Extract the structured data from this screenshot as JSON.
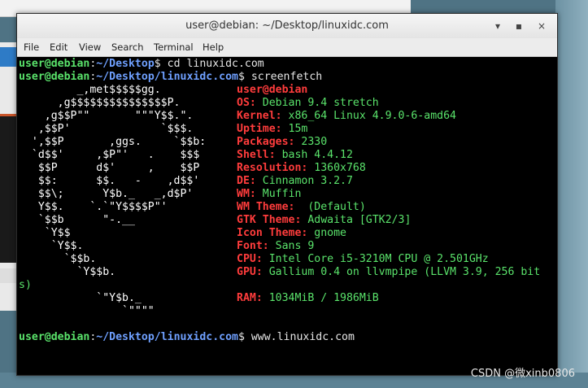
{
  "window": {
    "title": "user@debian: ~/Desktop/linuxidc.com",
    "controls": [
      "▾",
      "▪",
      "×"
    ]
  },
  "menu": [
    "File",
    "Edit",
    "View",
    "Search",
    "Terminal",
    "Help"
  ],
  "prompts": [
    {
      "user": "user@debian",
      "sep": ":",
      "path": "~/Desktop",
      "sym": "$",
      "cmd": " cd linuxidc.com"
    },
    {
      "user": "user@debian",
      "sep": ":",
      "path": "~/Desktop/linuxidc.com",
      "sym": "$",
      "cmd": " screenfetch"
    },
    {
      "user": "user@debian",
      "sep": ":",
      "path": "~/Desktop/linuxidc.com",
      "sym": "$",
      "cmd": " www.linuxidc.com"
    }
  ],
  "logo": [
    "         _,met$$$$$gg.",
    "      ,g$$$$$$$$$$$$$$$P.",
    "    ,g$$P\"\"       \"\"\"Y$$.\".",
    "   ,$$P'              `$$$.",
    "  ',$$P       ,ggs.     `$$b:",
    "  `d$$'     ,$P\"'   .    $$$",
    "   $$P      d$'     ,    $$P",
    "   $$:      $$.   -    ,d$$'",
    "   $$\\;      Y$b._   _,d$P'",
    "   Y$$.    `.`\"Y$$$$P\"'",
    "   `$$b      \"-.__",
    "    `Y$$",
    "     `Y$$.",
    "       `$$b.",
    "         `Y$$b.",
    "",
    "            `\"Y$b._",
    "                `\"\"\"\""
  ],
  "info": {
    "user_host": "user@debian",
    "rows": [
      {
        "label": "OS:",
        "value": " Debian 9.4 stretch"
      },
      {
        "label": "Kernel:",
        "value": " x86_64 Linux 4.9.0-6-amd64"
      },
      {
        "label": "Uptime:",
        "value": " 15m"
      },
      {
        "label": "Packages:",
        "value": " 2330"
      },
      {
        "label": "Shell:",
        "value": " bash 4.4.12"
      },
      {
        "label": "Resolution:",
        "value": " 1360x768"
      },
      {
        "label": "DE:",
        "value": " Cinnamon 3.2.7"
      },
      {
        "label": "WM:",
        "value": " Muffin"
      },
      {
        "label": "WM Theme:",
        "value": "  (Default)"
      },
      {
        "label": "GTK Theme:",
        "value": " Adwaita [GTK2/3]"
      },
      {
        "label": "Icon Theme:",
        "value": " gnome"
      },
      {
        "label": "Font:",
        "value": " Sans 9"
      },
      {
        "label": "CPU:",
        "value": " Intel Core i5-3210M CPU @ 2.501GHz"
      },
      {
        "label": "GPU:",
        "value": " Gallium 0.4 on llvmpipe (LLVM 3.9, 256 bit"
      }
    ],
    "gpu_wrap": "s)",
    "ram": {
      "label": "RAM:",
      "value": " 1034MiB / 1986MiB"
    }
  },
  "watermark": "CSDN @微xinb0806",
  "colors": {
    "prompt": "#5ae36b",
    "path": "#6fa0ff",
    "label": "#ff3c3c",
    "value": "#5ae36b"
  }
}
